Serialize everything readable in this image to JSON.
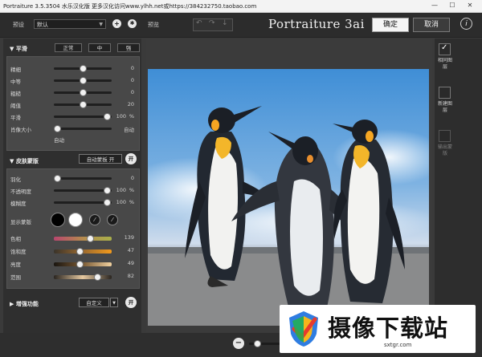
{
  "window": {
    "title": "Portraiture 3.5.3504 水乐汉化版    更多汉化访问www.ylhh.net或https://384232750.taobao.com",
    "controls": [
      "—",
      "☐",
      "✕"
    ]
  },
  "toolbar": {
    "preset_label": "预设",
    "preset_value": "默认",
    "preview_label": "预览",
    "undo_glyphs": [
      "↶",
      "↷",
      "↓"
    ],
    "logo": "Portraiture 3ai",
    "ok_label": "确定",
    "cancel_label": "取消",
    "info_glyph": "i"
  },
  "smoothing": {
    "title": "平滑",
    "modes": [
      "正常",
      "中",
      "强"
    ],
    "rows": [
      {
        "label": "精细",
        "value": "0",
        "pos": 0.5
      },
      {
        "label": "中等",
        "value": "0",
        "pos": 0.5
      },
      {
        "label": "粗糙",
        "value": "0",
        "pos": 0.5
      },
      {
        "label": "阈值",
        "value": "20",
        "pos": 0.5
      },
      {
        "label": "平滑",
        "value": "100",
        "unit": "%",
        "pos": 0.92
      }
    ],
    "portrait_size_label": "肖像大小",
    "portrait_size_value": "自动",
    "portrait_size_note": "自动",
    "portrait_size_pos": 0.05
  },
  "skin_mask": {
    "title": "皮肤蒙版",
    "auto_button": "自动蒙板 开",
    "toggle": "开",
    "rows": [
      {
        "label": "羽化",
        "value": "0",
        "pos": 0.05
      },
      {
        "label": "不透明度",
        "value": "100",
        "unit": "%",
        "pos": 0.92
      },
      {
        "label": "模糊度",
        "value": "100",
        "unit": "%",
        "pos": 0.92
      }
    ],
    "show_mask_label": "显示蒙版",
    "color_rows": [
      {
        "label": "色相",
        "value": "139",
        "pos": 0.62,
        "gradient": [
          "#b8466e",
          "#b58a4e",
          "#a9b04a"
        ]
      },
      {
        "label": "饱和度",
        "value": "47",
        "pos": 0.45,
        "gradient": [
          "#3a332a",
          "#9b6a2f",
          "#f39a1c"
        ]
      },
      {
        "label": "亮度",
        "value": "49",
        "pos": 0.45,
        "gradient": [
          "#1a1510",
          "#7a5a34",
          "#f2d2a0"
        ]
      },
      {
        "label": "范围",
        "value": "82",
        "pos": 0.75,
        "gradient": [
          "#2a2520",
          "#e6c9a0",
          "#2a2520"
        ]
      }
    ]
  },
  "enhance": {
    "title": "增强功能",
    "preset": "自定义",
    "toggle": "开"
  },
  "right_panel": {
    "items": [
      {
        "label": "相同图层",
        "checked": true
      },
      {
        "label": "新建图层",
        "checked": false
      },
      {
        "label": "输出蒙版",
        "checked": false
      }
    ]
  },
  "bottom": {
    "zoom_minus": "−",
    "zoom_plus": "+"
  },
  "watermark": {
    "title": "摄像下载站",
    "url": "sxtgr.com"
  },
  "colors": {
    "accent_white": "#f5f5f5",
    "panel": "#484848",
    "background": "#3a3a3a"
  }
}
